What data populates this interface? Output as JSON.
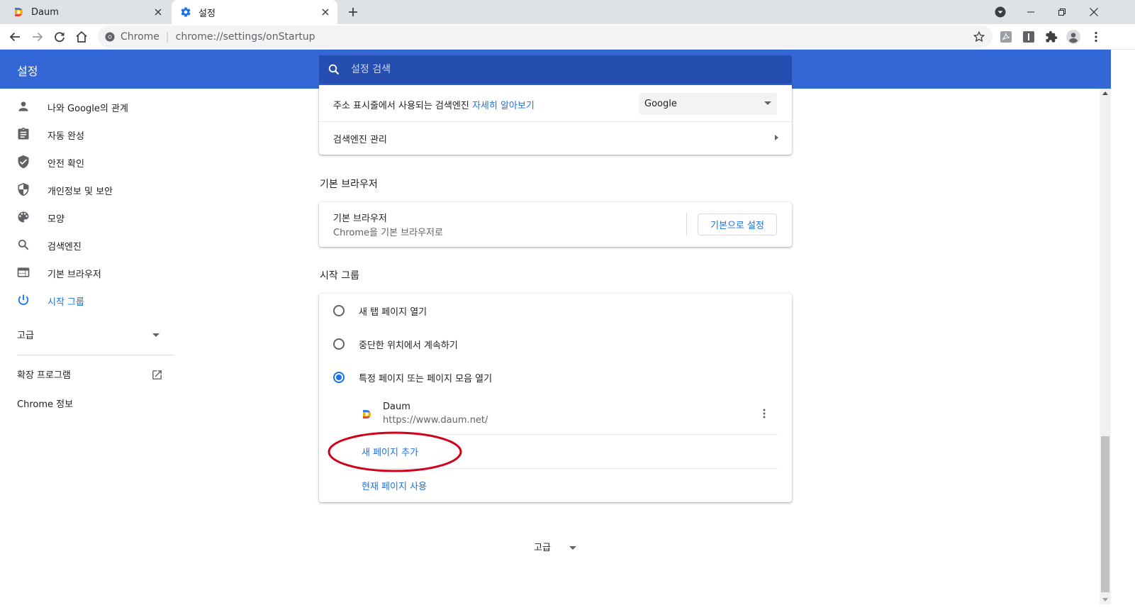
{
  "colors": {
    "accent": "#1a73e8",
    "header_blue": "#3367d6",
    "search_bg": "#254eb0",
    "annotation_red": "#d0021b",
    "tab_strip": "#dee1e6"
  },
  "tabs": [
    {
      "title": "Daum",
      "icon": "daum-favicon",
      "active": false
    },
    {
      "title": "설정",
      "icon": "gear-icon",
      "active": true
    }
  ],
  "toolbar": {
    "site_label": "Chrome",
    "url": "chrome://settings/onStartup"
  },
  "header": {
    "title": "설정",
    "search_placeholder": "설정 검색"
  },
  "sidebar": {
    "items": [
      {
        "label": "나와 Google의 관계",
        "icon": "person-icon"
      },
      {
        "label": "자동 완성",
        "icon": "clipboard-icon"
      },
      {
        "label": "안전 확인",
        "icon": "shield-check-icon"
      },
      {
        "label": "개인정보 및 보안",
        "icon": "shield-half-icon"
      },
      {
        "label": "모양",
        "icon": "palette-icon"
      },
      {
        "label": "검색엔진",
        "icon": "search-icon"
      },
      {
        "label": "기본 브라우저",
        "icon": "browser-icon"
      },
      {
        "label": "시작 그룹",
        "icon": "power-icon",
        "active": true
      }
    ],
    "advanced": "고급",
    "extensions": "확장 프로그램",
    "about": "Chrome 정보"
  },
  "search_engine": {
    "address_bar_label": "주소 표시줄에서 사용되는 검색엔진",
    "learn_more": "자세히 알아보기",
    "selected": "Google",
    "manage": "검색엔진 관리"
  },
  "default_browser": {
    "section_title": "기본 브라우저",
    "row_title": "기본 브라우저",
    "row_sub": "Chrome을 기본 브라우저로",
    "button": "기본으로 설정"
  },
  "startup": {
    "section_title": "시작 그룹",
    "options": [
      {
        "label": "새 탭 페이지 열기",
        "selected": false
      },
      {
        "label": "중단한 위치에서 계속하기",
        "selected": false
      },
      {
        "label": "특정 페이지 또는 페이지 모음 열기",
        "selected": true
      }
    ],
    "pages": [
      {
        "title": "Daum",
        "url": "https://www.daum.net/"
      }
    ],
    "add_page": "새 페이지 추가",
    "use_current": "현재 페이지 사용"
  },
  "advanced_bottom": "고급"
}
